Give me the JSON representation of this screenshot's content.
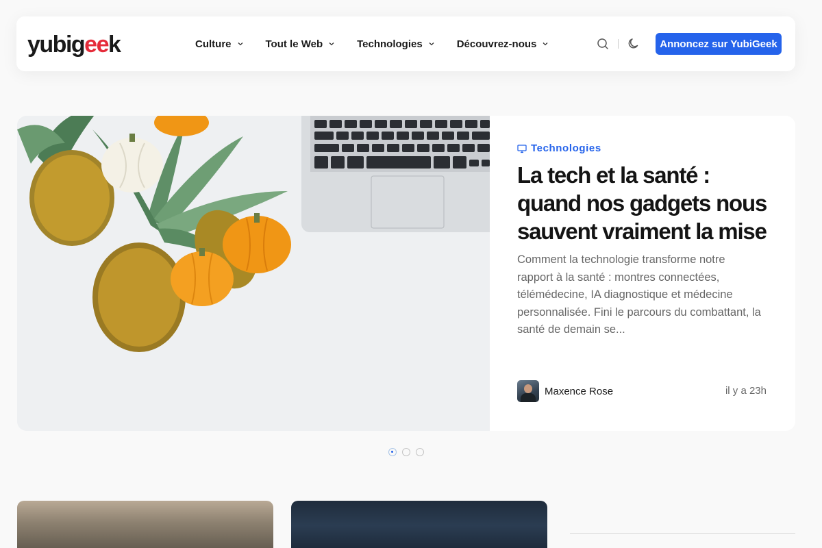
{
  "header": {
    "logo": {
      "prefix": "yubig",
      "highlight": "ee",
      "suffix": "k"
    },
    "nav": [
      {
        "label": "Culture"
      },
      {
        "label": "Tout le Web"
      },
      {
        "label": "Technologies"
      },
      {
        "label": "Découvrez-nous"
      }
    ],
    "icons": {
      "search": "search-icon",
      "theme": "moon-icon"
    },
    "cta_label": "Annoncez sur YubiGeek",
    "accent_color": "#2563eb",
    "logo_accent_color": "#e52c3a"
  },
  "featured": {
    "category": "Technologies",
    "category_icon": "monitor-icon",
    "title": "La tech et la santé : quand nos gadgets nous sauvent vraiment la mise",
    "excerpt": "Comment la technologie transforme notre rapport à la santé : montres connectées, télémédecine, IA diagnostique et médecine personnalisée. Fini le parcours du combattant, la santé de demain se...",
    "author": "Maxence Rose",
    "time": "il y a 23h"
  },
  "carousel": {
    "count": 3,
    "active_index": 0
  }
}
